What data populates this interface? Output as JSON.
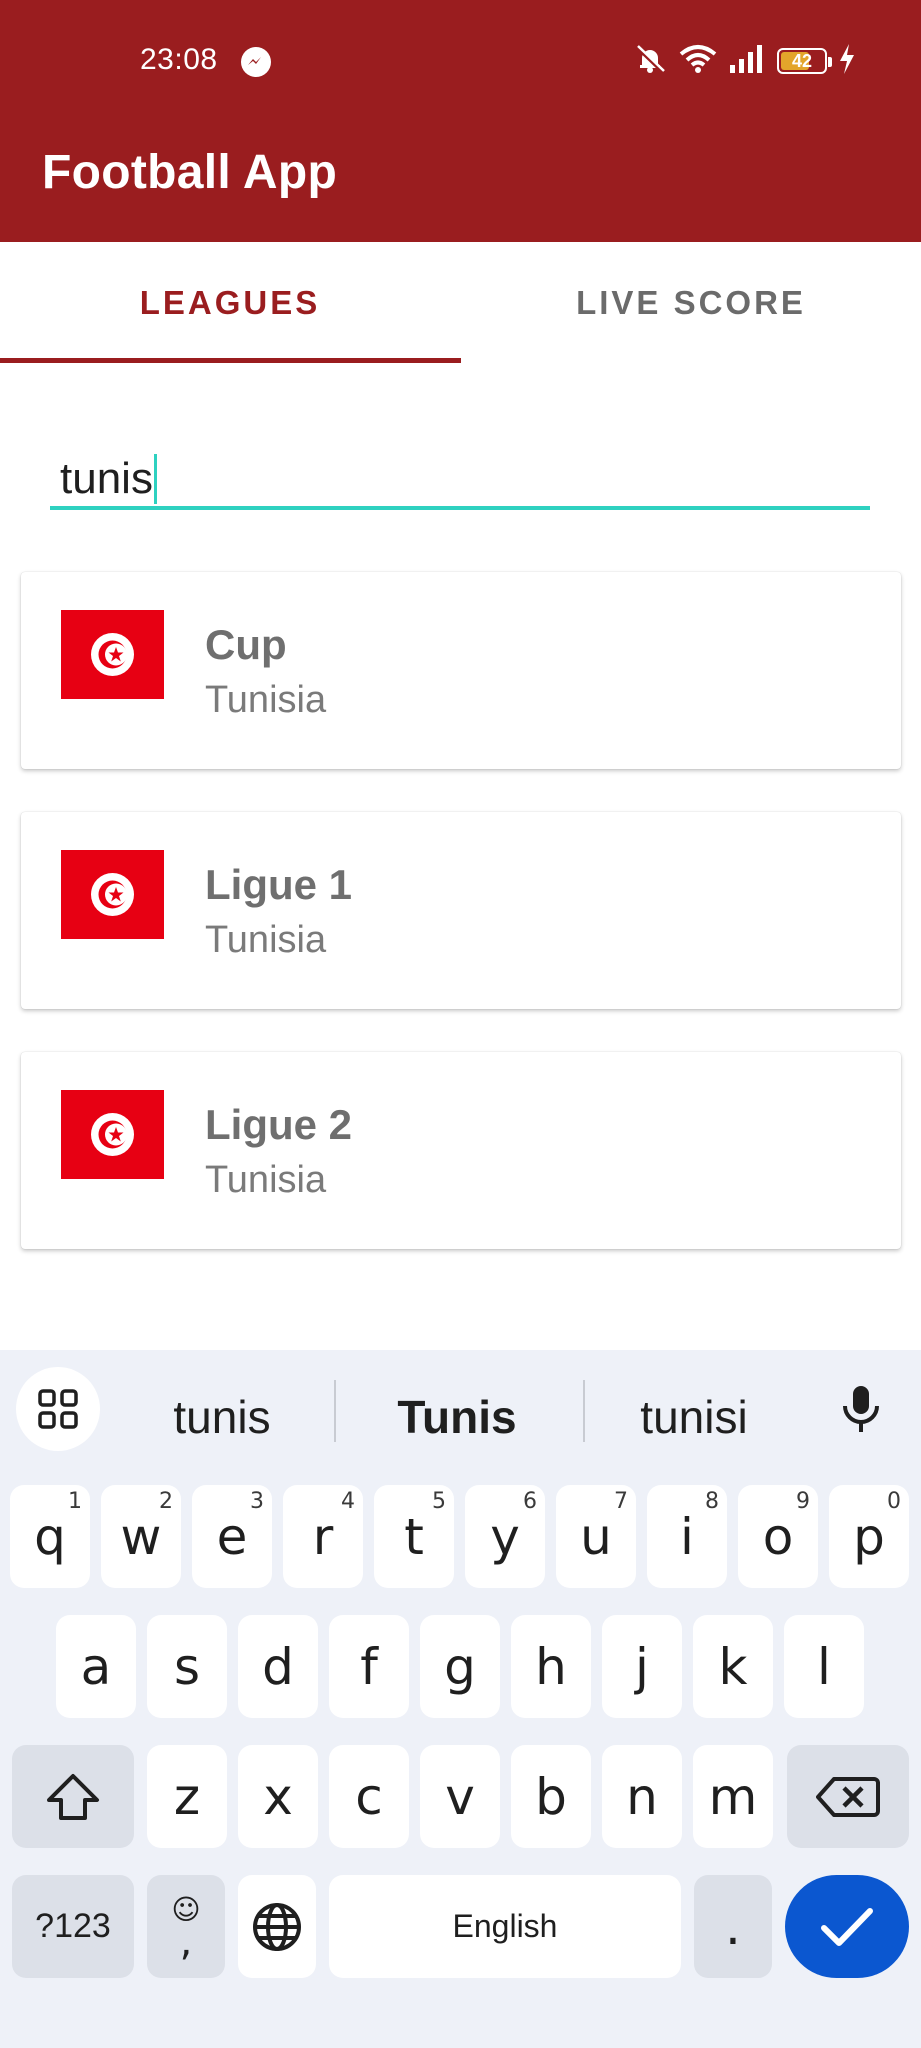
{
  "status_bar": {
    "time": "23:08",
    "battery": "42"
  },
  "app": {
    "title": "Football App"
  },
  "tabs": [
    {
      "label": "LEAGUES",
      "selected": true
    },
    {
      "label": "LIVE SCORE",
      "selected": false
    }
  ],
  "search": {
    "value": "tunis"
  },
  "leagues": [
    {
      "name": "Cup",
      "country": "Tunisia",
      "flag": "tunisia-flag-icon"
    },
    {
      "name": "Ligue 1",
      "country": "Tunisia",
      "flag": "tunisia-flag-icon"
    },
    {
      "name": "Ligue 2",
      "country": "Tunisia",
      "flag": "tunisia-flag-icon"
    }
  ],
  "keyboard": {
    "suggestions": [
      "tunis",
      "Tunis",
      "tunisi"
    ],
    "row1": [
      {
        "key": "q",
        "hint": "1"
      },
      {
        "key": "w",
        "hint": "2"
      },
      {
        "key": "e",
        "hint": "3"
      },
      {
        "key": "r",
        "hint": "4"
      },
      {
        "key": "t",
        "hint": "5"
      },
      {
        "key": "y",
        "hint": "6"
      },
      {
        "key": "u",
        "hint": "7"
      },
      {
        "key": "i",
        "hint": "8"
      },
      {
        "key": "o",
        "hint": "9"
      },
      {
        "key": "p",
        "hint": "0"
      }
    ],
    "row2": [
      "a",
      "s",
      "d",
      "f",
      "g",
      "h",
      "j",
      "k",
      "l"
    ],
    "row3": [
      "z",
      "x",
      "c",
      "v",
      "b",
      "n",
      "m"
    ],
    "symbols_label": "?123",
    "emoji_label": "☺",
    "comma_label": ",",
    "space_label": "English",
    "period_label": "."
  },
  "colors": {
    "primary": "#9a1d1f",
    "accent": "#2ed1c0",
    "flag_red": "#e70013",
    "enter_blue": "#0b57d0"
  }
}
